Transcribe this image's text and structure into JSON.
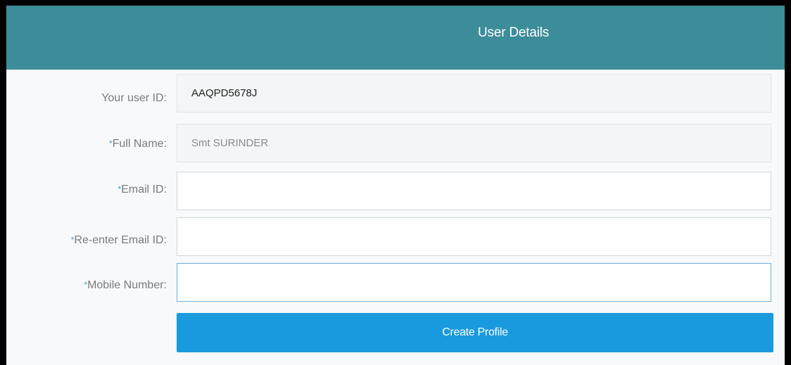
{
  "header": {
    "title": "User Details"
  },
  "form": {
    "user_id": {
      "label": "Your user ID:",
      "value": "AAQPD5678J"
    },
    "full_name": {
      "required_marker": "*",
      "label": "Full Name:",
      "value": "Smt SURINDER"
    },
    "email": {
      "required_marker": "*",
      "label": "Email ID:",
      "value": ""
    },
    "reenter_email": {
      "required_marker": "*",
      "label": "Re-enter Email ID:",
      "value": ""
    },
    "mobile": {
      "required_marker": "*",
      "label": "Mobile Number:",
      "value": ""
    },
    "submit_label": "Create Profile"
  },
  "colors": {
    "header_bg": "#3d8c99",
    "button_bg": "#1a9ade",
    "required_marker": "#4aa3c5"
  }
}
